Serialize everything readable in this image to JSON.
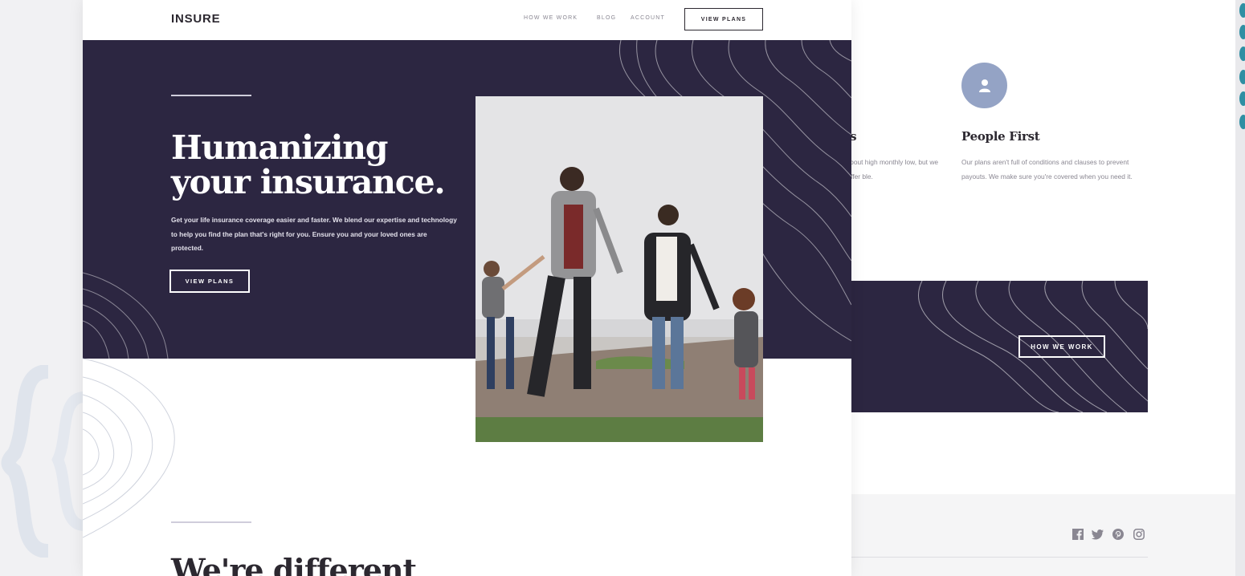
{
  "brand": {
    "logo_text": "INSURE"
  },
  "nav": {
    "links": [
      "HOW WE WORK",
      "BLOG",
      "ACCOUNT"
    ],
    "cta_label": "VIEW PLANS"
  },
  "hero": {
    "title_line1": "Humanizing",
    "title_line2": "your insurance.",
    "description": "Get your life insurance coverage easier and faster. We blend our expertise and technology to help you find the plan that's right for you. Ensure you and your loved ones are protected.",
    "button_label": "VIEW PLANS"
  },
  "section": {
    "title": "We're different"
  },
  "features": {
    "partial_title": "ces",
    "partial_text": "ing about high monthly low, but we still offer ble.",
    "people_first": {
      "icon": "person-icon",
      "title": "People First",
      "text": "Our plans aren't full of conditions and clauses to prevent payouts. We make sure you're covered when you need it."
    }
  },
  "cta_band": {
    "button_label": "HOW WE WORK"
  },
  "footer": {
    "social_icons": [
      "facebook-icon",
      "twitter-icon",
      "pinterest-icon",
      "instagram-icon"
    ]
  },
  "colors": {
    "dark_violet": "#2c2641",
    "icon_blue": "#94a3c5",
    "accent_teal": "#2f8fa3",
    "text_dark": "#2c2830"
  }
}
